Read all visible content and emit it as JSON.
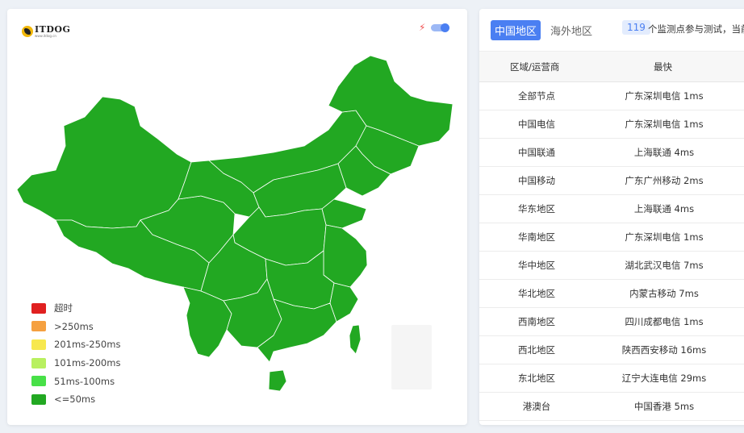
{
  "logo": {
    "name": "ITDOG",
    "url": "www.itdog.cn"
  },
  "map": {
    "region_fill": "#22a822",
    "legend": [
      {
        "label": "超时",
        "color": "#e02020"
      },
      {
        "label": ">250ms",
        "color": "#f5a040"
      },
      {
        "label": "201ms-250ms",
        "color": "#f7e84e"
      },
      {
        "label": "101ms-200ms",
        "color": "#b8f060"
      },
      {
        "label": "51ms-100ms",
        "color": "#48e048"
      },
      {
        "label": "<=50ms",
        "color": "#22a822"
      }
    ]
  },
  "tabs": {
    "domestic": "中国地区",
    "overseas": "海外地区"
  },
  "summary": {
    "count": "119",
    "text": "个监测点参与测试，当前"
  },
  "table": {
    "headers": {
      "region": "区域/运营商",
      "fastest": "最快"
    },
    "rows": [
      {
        "region": "全部节点",
        "fastest": "广东深圳电信 1ms"
      },
      {
        "region": "中国电信",
        "fastest": "广东深圳电信 1ms"
      },
      {
        "region": "中国联通",
        "fastest": "上海联通 4ms"
      },
      {
        "region": "中国移动",
        "fastest": "广东广州移动 2ms"
      },
      {
        "region": "华东地区",
        "fastest": "上海联通 4ms"
      },
      {
        "region": "华南地区",
        "fastest": "广东深圳电信 1ms"
      },
      {
        "region": "华中地区",
        "fastest": "湖北武汉电信 7ms"
      },
      {
        "region": "华北地区",
        "fastest": "内蒙古移动 7ms"
      },
      {
        "region": "西南地区",
        "fastest": "四川成都电信 1ms"
      },
      {
        "region": "西北地区",
        "fastest": "陕西西安移动 16ms"
      },
      {
        "region": "东北地区",
        "fastest": "辽宁大连电信 29ms"
      },
      {
        "region": "港澳台",
        "fastest": "中国香港 5ms"
      }
    ]
  }
}
